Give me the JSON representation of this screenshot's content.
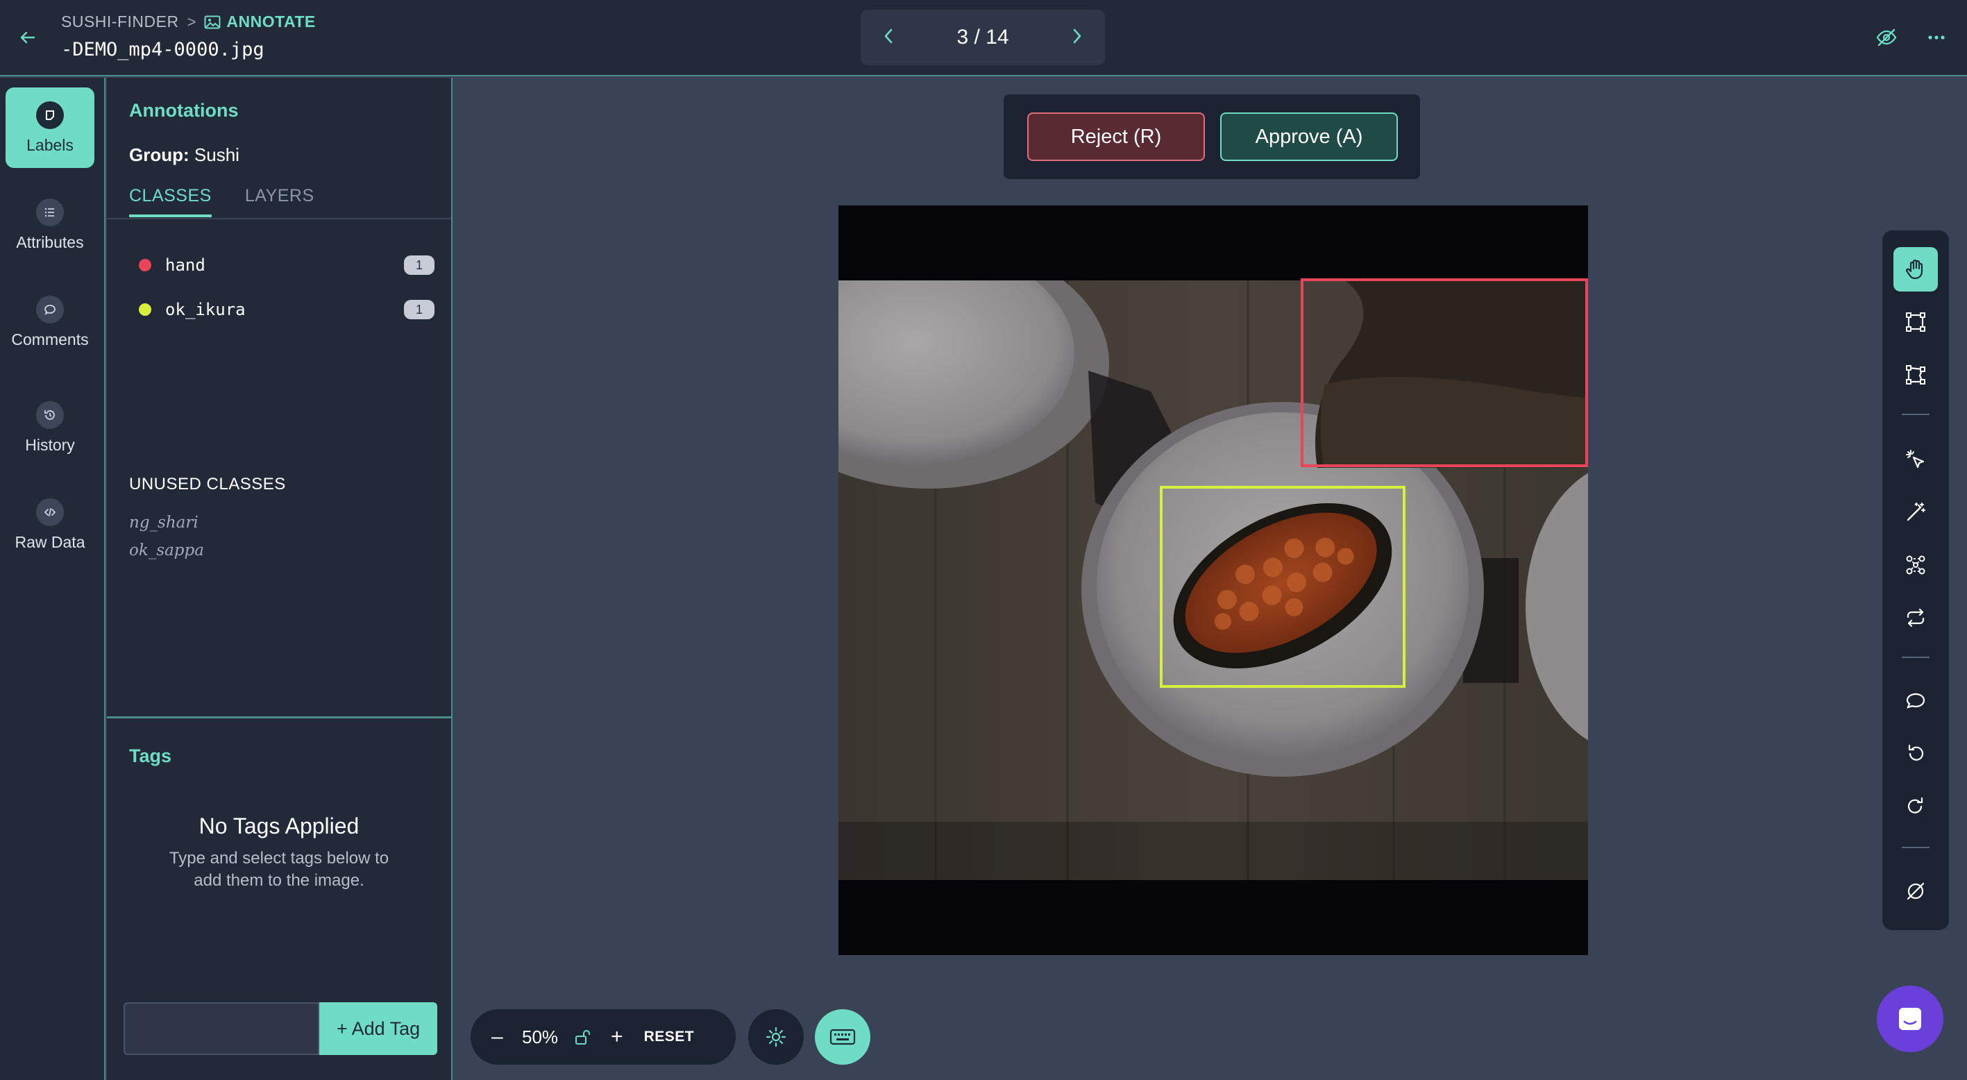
{
  "header": {
    "project": "SUSHI-FINDER",
    "separator": ">",
    "mode": "ANNOTATE",
    "filename": "-DEMO_mp4-0000.jpg",
    "pager": "3 / 14"
  },
  "rail": {
    "items": [
      {
        "label": "Labels",
        "icon": "label-icon",
        "active": true
      },
      {
        "label": "Attributes",
        "icon": "list-icon"
      },
      {
        "label": "Comments",
        "icon": "comment-icon"
      },
      {
        "label": "History",
        "icon": "history-icon"
      },
      {
        "label": "Raw Data",
        "icon": "code-icon"
      }
    ]
  },
  "panel": {
    "title": "Annotations",
    "group_label": "Group:",
    "group_value": "Sushi",
    "tabs": [
      {
        "label": "CLASSES",
        "active": true
      },
      {
        "label": "LAYERS",
        "active": false
      }
    ],
    "classes": [
      {
        "name": "hand",
        "count": "1",
        "color": "#e8455a"
      },
      {
        "name": "ok_ikura",
        "count": "1",
        "color": "#d7ef3d"
      }
    ],
    "unused_title": "UNUSED CLASSES",
    "unused": [
      "ng_shari",
      "ok_sappa"
    ],
    "tags_title": "Tags",
    "no_tags_heading": "No Tags Applied",
    "no_tags_line1": "Type and select tags below to",
    "no_tags_line2": "add them to the image.",
    "tag_input_value": "",
    "add_tag_label": "+ Add Tag"
  },
  "review": {
    "reject_label": "Reject (R)",
    "approve_label": "Approve (A)"
  },
  "annotations": [
    {
      "class": "hand",
      "color": "#e8455a"
    },
    {
      "class": "ok_ikura",
      "color": "#d7ef3d"
    }
  ],
  "zoom": {
    "minus": "–",
    "value": "50%",
    "plus": "+",
    "reset_label": "RESET"
  },
  "colors": {
    "accent": "#6fdcc6",
    "background": "#3a4256",
    "panel": "#222a3a",
    "reject": "#e46b78",
    "chat": "#6b3fd9"
  }
}
